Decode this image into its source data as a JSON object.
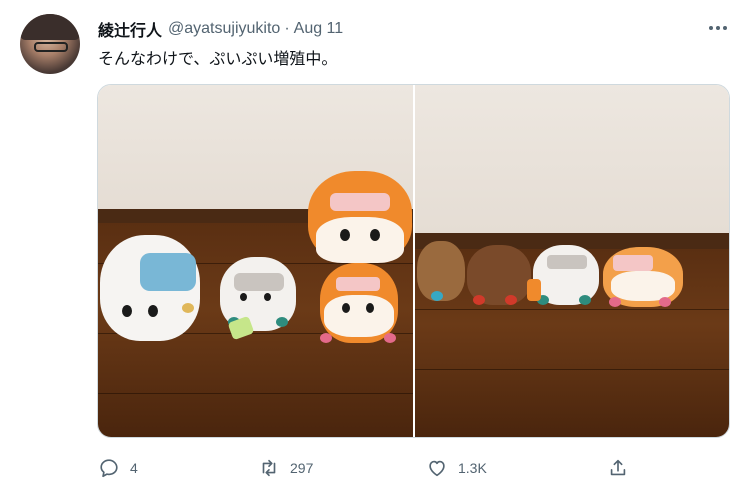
{
  "tweet": {
    "author_name": "綾辻行人",
    "handle": "@ayatsujiyukito",
    "separator": "·",
    "date": "Aug 11",
    "text": "そんなわけで、ぷいぷい増殖中。",
    "more_icon": "more-horizontal-icon"
  },
  "media": {
    "photos": [
      {
        "name": "photo-left"
      },
      {
        "name": "photo-right"
      }
    ]
  },
  "actions": {
    "reply_count": "4",
    "retweet_count": "297",
    "like_count": "1.3K",
    "icons": [
      "reply-icon",
      "retweet-icon",
      "like-icon",
      "share-icon"
    ]
  },
  "colors": {
    "text_primary": "#0f1419",
    "text_secondary": "#536471",
    "border": "#cfd9de"
  }
}
